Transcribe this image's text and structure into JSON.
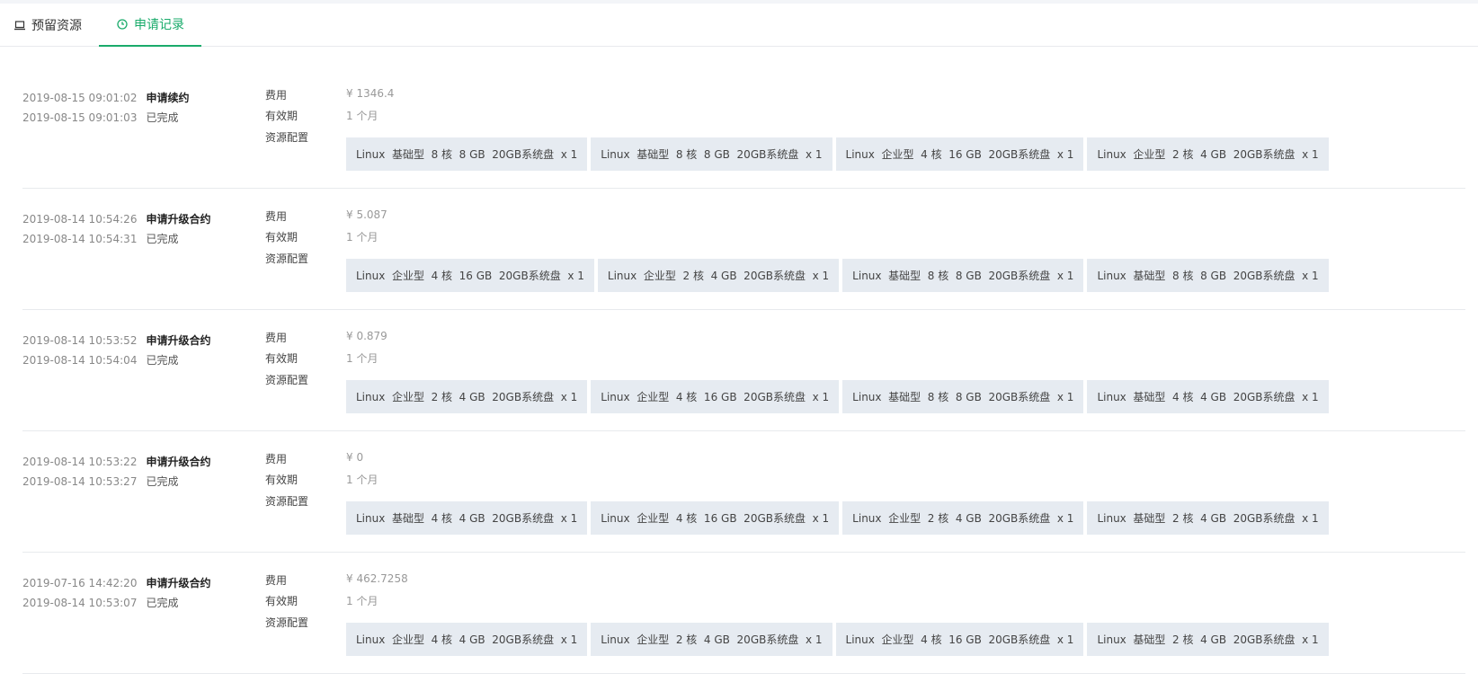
{
  "tabs": [
    {
      "label": "预留资源",
      "icon": "laptop-icon"
    },
    {
      "label": "申请记录",
      "icon": "clock-icon",
      "active": true,
      "color": "#1aab6b"
    }
  ],
  "field_labels": {
    "fee": "费用",
    "validity": "有效期",
    "config": "资源配置"
  },
  "records": [
    {
      "apply_time": "2019-08-15 09:01:02",
      "action": "申请续约",
      "done_time": "2019-08-15 09:01:03",
      "status": "已完成",
      "fee": "¥ 1346.4",
      "validity": "1 个月",
      "configs": [
        "Linux  基础型  8 核  8 GB  20GB系统盘  x 1",
        "Linux  基础型  8 核  8 GB  20GB系统盘  x 1",
        "Linux  企业型  4 核  16 GB  20GB系统盘  x 1",
        "Linux  企业型  2 核  4 GB  20GB系统盘  x 1"
      ]
    },
    {
      "apply_time": "2019-08-14 10:54:26",
      "action": "申请升级合约",
      "done_time": "2019-08-14 10:54:31",
      "status": "已完成",
      "fee": "¥ 5.087",
      "validity": "1 个月",
      "configs": [
        "Linux  企业型  4 核  16 GB  20GB系统盘  x 1",
        "Linux  企业型  2 核  4 GB  20GB系统盘  x 1",
        "Linux  基础型  8 核  8 GB  20GB系统盘  x 1",
        "Linux  基础型  8 核  8 GB  20GB系统盘  x 1"
      ]
    },
    {
      "apply_time": "2019-08-14 10:53:52",
      "action": "申请升级合约",
      "done_time": "2019-08-14 10:54:04",
      "status": "已完成",
      "fee": "¥ 0.879",
      "validity": "1 个月",
      "configs": [
        "Linux  企业型  2 核  4 GB  20GB系统盘  x 1",
        "Linux  企业型  4 核  16 GB  20GB系统盘  x 1",
        "Linux  基础型  8 核  8 GB  20GB系统盘  x 1",
        "Linux  基础型  4 核  4 GB  20GB系统盘  x 1"
      ]
    },
    {
      "apply_time": "2019-08-14 10:53:22",
      "action": "申请升级合约",
      "done_time": "2019-08-14 10:53:27",
      "status": "已完成",
      "fee": "¥ 0",
      "validity": "1 个月",
      "configs": [
        "Linux  基础型  4 核  4 GB  20GB系统盘  x 1",
        "Linux  企业型  4 核  16 GB  20GB系统盘  x 1",
        "Linux  企业型  2 核  4 GB  20GB系统盘  x 1",
        "Linux  基础型  2 核  4 GB  20GB系统盘  x 1"
      ]
    },
    {
      "apply_time": "2019-07-16 14:42:20",
      "action": "申请升级合约",
      "done_time": "2019-08-14 10:53:07",
      "status": "已完成",
      "fee": "¥ 462.7258",
      "validity": "1 个月",
      "configs": [
        "Linux  企业型  4 核  4 GB  20GB系统盘  x 1",
        "Linux  企业型  2 核  4 GB  20GB系统盘  x 1",
        "Linux  企业型  4 核  16 GB  20GB系统盘  x 1",
        "Linux  基础型  2 核  4 GB  20GB系统盘  x 1"
      ]
    }
  ]
}
